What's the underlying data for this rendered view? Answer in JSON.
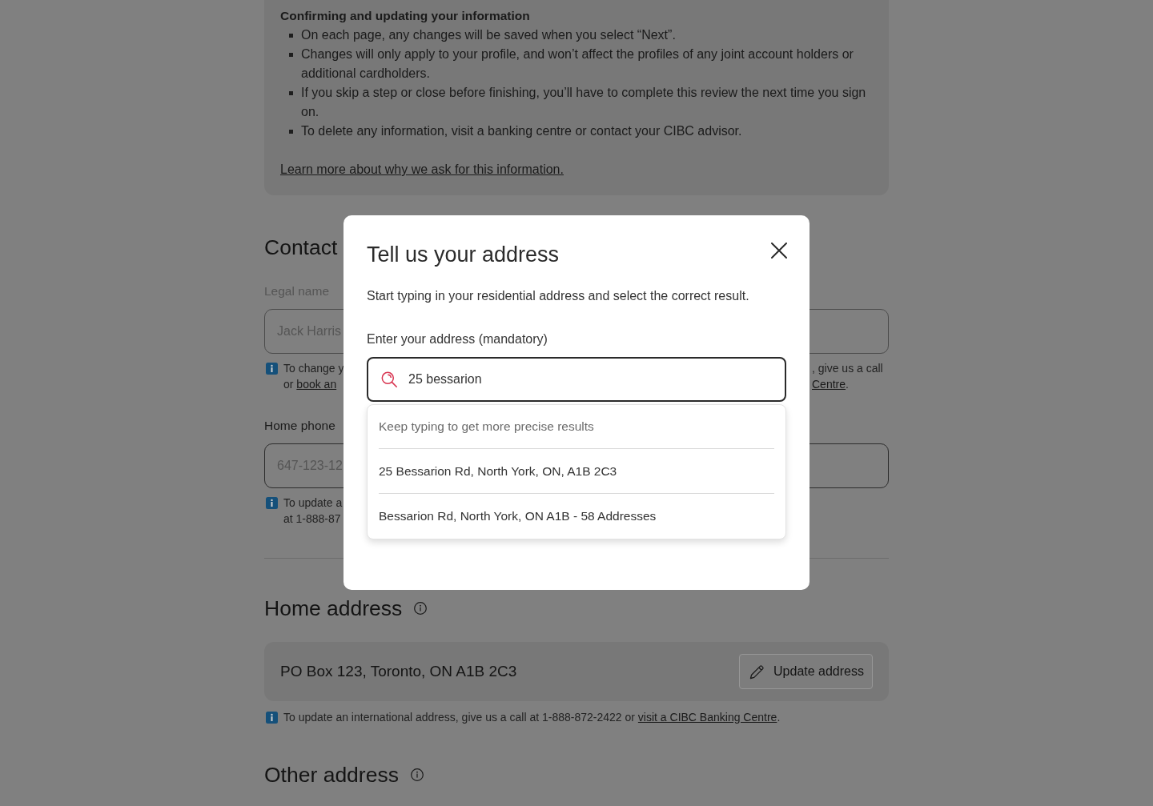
{
  "info_panel": {
    "title": "Confirming and updating your information",
    "bullets": [
      "On each page, any changes will be saved when you select “Next”.",
      "Changes will only apply to your profile, and won’t affect the profiles of any joint account holders or additional cardholders.",
      "If you skip a step or close before finishing, you’ll have to complete this review the next time you sign on.",
      "To delete any information, visit a banking centre or contact your CIBC advisor."
    ],
    "link": "Learn more about why we ask for this information."
  },
  "contact_section": {
    "heading": "Contact",
    "fields": [
      {
        "label": "Legal name",
        "value": "Jack Harris",
        "disabled": true,
        "note_left": [
          [
            {
              "kind": "text",
              "text": "To change y"
            }
          ],
          [
            {
              "kind": "text",
              "text": "or "
            },
            {
              "kind": "link",
              "text": "book an"
            }
          ]
        ],
        "note_right": [
          [
            {
              "kind": "text",
              "text": ", give us a call"
            }
          ],
          [
            {
              "kind": "link",
              "text": "Centre"
            },
            {
              "kind": "text",
              "text": "."
            }
          ]
        ]
      },
      {
        "label": "Home phone",
        "placeholder": "647-123-12",
        "disabled": false,
        "note_left": [
          [
            {
              "kind": "text",
              "text": "To update a"
            }
          ],
          [
            {
              "kind": "text",
              "text": "at 1-888-87"
            }
          ]
        ]
      }
    ]
  },
  "home_address": {
    "heading": "Home address",
    "address": "PO Box 123, Toronto, ON A1B 2C3",
    "button": "Update address",
    "note": [
      {
        "kind": "text",
        "text": "To update an international address, give us a call at 1-888-872-2422 or "
      },
      {
        "kind": "link",
        "text": "visit a CIBC Banking Centre"
      },
      {
        "kind": "text",
        "text": "."
      }
    ]
  },
  "other_address": {
    "heading": "Other address"
  },
  "dialog": {
    "title": "Tell us your address",
    "description": "Start typing in your residential address and select the correct result.",
    "field_label": "Enter your address (mandatory)",
    "input_value": "25 bessarion",
    "hint": "Keep typing to get more precise results",
    "results": [
      "25 Bessarion Rd, North York, ON, A1B 2C3",
      "Bessarion Rd, North York, ON A1B - 58 Addresses"
    ]
  }
}
